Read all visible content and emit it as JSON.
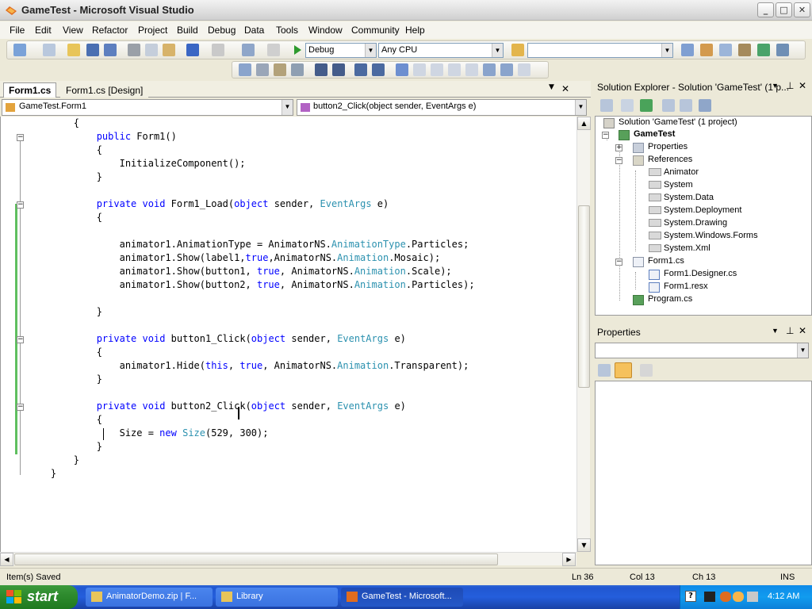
{
  "window": {
    "title": "GameTest - Microsoft Visual Studio",
    "min": "_",
    "max": "□",
    "close": "✕"
  },
  "menu": [
    "File",
    "Edit",
    "View",
    "Refactor",
    "Project",
    "Build",
    "Debug",
    "Data",
    "Tools",
    "Window",
    "Community",
    "Help"
  ],
  "toolbar": {
    "config": "Debug",
    "platform": "Any CPU"
  },
  "editor": {
    "tabs": [
      "Form1.cs",
      "Form1.cs [Design]"
    ],
    "class_dropdown": "GameTest.Form1",
    "member_dropdown": "button2_Click(object sender, EventArgs e)"
  },
  "code": [
    [
      [
        "t",
        "        {"
      ]
    ],
    [
      [
        "t",
        "            "
      ],
      [
        "k",
        "public"
      ],
      [
        "t",
        " Form1()"
      ]
    ],
    [
      [
        "t",
        "            {"
      ]
    ],
    [
      [
        "t",
        "                InitializeComponent();"
      ]
    ],
    [
      [
        "t",
        "            }"
      ]
    ],
    [
      [
        "t",
        ""
      ]
    ],
    [
      [
        "t",
        "            "
      ],
      [
        "k",
        "private"
      ],
      [
        "t",
        " "
      ],
      [
        "k",
        "void"
      ],
      [
        "t",
        " Form1_Load("
      ],
      [
        "k",
        "object"
      ],
      [
        "t",
        " sender, "
      ],
      [
        "y",
        "EventArgs"
      ],
      [
        "t",
        " e)"
      ]
    ],
    [
      [
        "t",
        "            {"
      ]
    ],
    [
      [
        "t",
        ""
      ]
    ],
    [
      [
        "t",
        "                animator1.AnimationType = AnimatorNS."
      ],
      [
        "y",
        "AnimationType"
      ],
      [
        "t",
        ".Particles;"
      ]
    ],
    [
      [
        "t",
        "                animator1.Show(label1,"
      ],
      [
        "k",
        "true"
      ],
      [
        "t",
        ",AnimatorNS."
      ],
      [
        "y",
        "Animation"
      ],
      [
        "t",
        ".Mosaic);"
      ]
    ],
    [
      [
        "t",
        "                animator1.Show(button1, "
      ],
      [
        "k",
        "true"
      ],
      [
        "t",
        ", AnimatorNS."
      ],
      [
        "y",
        "Animation"
      ],
      [
        "t",
        ".Scale);"
      ]
    ],
    [
      [
        "t",
        "                animator1.Show(button2, "
      ],
      [
        "k",
        "true"
      ],
      [
        "t",
        ", AnimatorNS."
      ],
      [
        "y",
        "Animation"
      ],
      [
        "t",
        ".Particles);"
      ]
    ],
    [
      [
        "t",
        ""
      ]
    ],
    [
      [
        "t",
        "            }"
      ]
    ],
    [
      [
        "t",
        ""
      ]
    ],
    [
      [
        "t",
        "            "
      ],
      [
        "k",
        "private"
      ],
      [
        "t",
        " "
      ],
      [
        "k",
        "void"
      ],
      [
        "t",
        " button1_Click("
      ],
      [
        "k",
        "object"
      ],
      [
        "t",
        " sender, "
      ],
      [
        "y",
        "EventArgs"
      ],
      [
        "t",
        " e)"
      ]
    ],
    [
      [
        "t",
        "            {"
      ]
    ],
    [
      [
        "t",
        "                animator1.Hide("
      ],
      [
        "k",
        "this"
      ],
      [
        "t",
        ", "
      ],
      [
        "k",
        "true"
      ],
      [
        "t",
        ", AnimatorNS."
      ],
      [
        "y",
        "Animation"
      ],
      [
        "t",
        ".Transparent);"
      ]
    ],
    [
      [
        "t",
        "            }"
      ]
    ],
    [
      [
        "t",
        ""
      ]
    ],
    [
      [
        "t",
        "            "
      ],
      [
        "k",
        "private"
      ],
      [
        "t",
        " "
      ],
      [
        "k",
        "void"
      ],
      [
        "t",
        " button2_Click("
      ],
      [
        "k",
        "object"
      ],
      [
        "t",
        " sender, "
      ],
      [
        "y",
        "EventArgs"
      ],
      [
        "t",
        " e)"
      ]
    ],
    [
      [
        "t",
        "            {"
      ]
    ],
    [
      [
        "t",
        "                Size = "
      ],
      [
        "k",
        "new"
      ],
      [
        "t",
        " "
      ],
      [
        "y",
        "Size"
      ],
      [
        "t",
        "(529, 300);"
      ]
    ],
    [
      [
        "t",
        "            }"
      ]
    ],
    [
      [
        "t",
        "        }"
      ]
    ],
    [
      [
        "t",
        "    }"
      ]
    ]
  ],
  "solution_explorer": {
    "title": "Solution Explorer - Solution 'GameTest' (1 p...",
    "items": [
      {
        "label": "Solution 'GameTest' (1 project)",
        "bold": false
      },
      {
        "label": "GameTest",
        "bold": true
      },
      {
        "label": "Properties",
        "bold": false
      },
      {
        "label": "References",
        "bold": false
      },
      {
        "label": "Animator",
        "bold": false
      },
      {
        "label": "System",
        "bold": false
      },
      {
        "label": "System.Data",
        "bold": false
      },
      {
        "label": "System.Deployment",
        "bold": false
      },
      {
        "label": "System.Drawing",
        "bold": false
      },
      {
        "label": "System.Windows.Forms",
        "bold": false
      },
      {
        "label": "System.Xml",
        "bold": false
      },
      {
        "label": "Form1.cs",
        "bold": false
      },
      {
        "label": "Form1.Designer.cs",
        "bold": false
      },
      {
        "label": "Form1.resx",
        "bold": false
      },
      {
        "label": "Program.cs",
        "bold": false
      }
    ]
  },
  "properties": {
    "title": "Properties"
  },
  "status": {
    "message": "Item(s) Saved",
    "ln": "Ln 36",
    "col": "Col 13",
    "ch": "Ch 13",
    "mode": "INS"
  },
  "taskbar": {
    "start": "start",
    "tasks": [
      "AnimatorDemo.zip | F...",
      "Library",
      "GameTest - Microsoft..."
    ],
    "clock": "4:12 AM"
  },
  "colors": {
    "keyword": "#0000ff",
    "type": "#2b91af",
    "accent": "#316ac5"
  }
}
